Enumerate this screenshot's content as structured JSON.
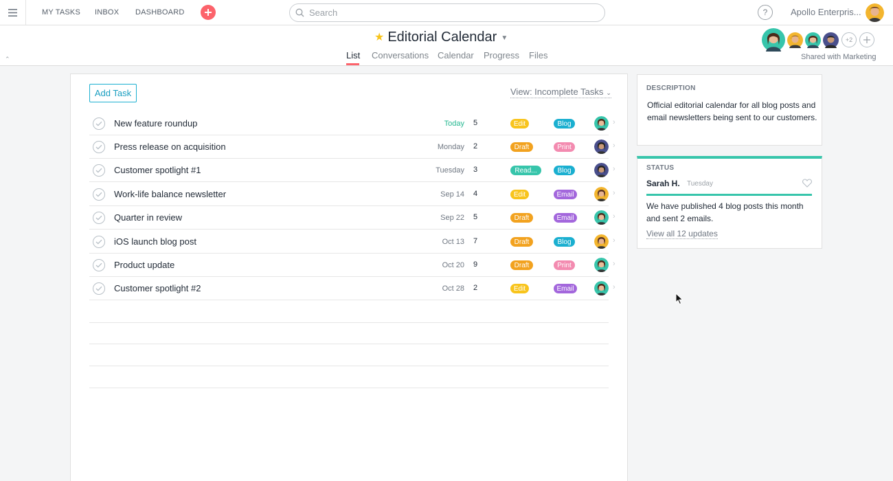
{
  "topbar": {
    "nav": [
      "MY TASKS",
      "INBOX",
      "DASHBOARD"
    ],
    "search_placeholder": "Search",
    "help": "?",
    "org_name": "Apollo Enterpris..."
  },
  "project": {
    "title": "Editorial Calendar",
    "tabs": [
      "List",
      "Conversations",
      "Calendar",
      "Progress",
      "Files"
    ],
    "active_tab": "List",
    "members_extra": "+2",
    "shared_label": "Shared with Marketing"
  },
  "list": {
    "add_task_label": "Add Task",
    "view_label": "View: Incomplete Tasks",
    "tasks": [
      {
        "name": "New feature roundup",
        "due": "Today",
        "count": "5",
        "tag1": "Edit",
        "tag2": "Blog"
      },
      {
        "name": "Press release on acquisition",
        "due": "Monday",
        "count": "2",
        "tag1": "Draft",
        "tag2": "Print"
      },
      {
        "name": "Customer spotlight #1",
        "due": "Tuesday",
        "count": "3",
        "tag1": "Read...",
        "tag2": "Blog"
      },
      {
        "name": "Work-life balance newsletter",
        "due": "Sep 14",
        "count": "4",
        "tag1": "Edit",
        "tag2": "Email"
      },
      {
        "name": "Quarter in review",
        "due": "Sep 22",
        "count": "5",
        "tag1": "Draft",
        "tag2": "Email"
      },
      {
        "name": "iOS launch blog post",
        "due": "Oct 13",
        "count": "7",
        "tag1": "Draft",
        "tag2": "Blog"
      },
      {
        "name": "Product update",
        "due": "Oct 20",
        "count": "9",
        "tag1": "Draft",
        "tag2": "Print"
      },
      {
        "name": "Customer spotlight #2",
        "due": "Oct 28",
        "count": "2",
        "tag1": "Edit",
        "tag2": "Email"
      }
    ]
  },
  "tag_colors": {
    "Edit": "#f8c41c",
    "Draft": "#f2a21f",
    "Read...": "#37c5ab",
    "Blog": "#1aafd0",
    "Print": "#f38bb0",
    "Email": "#a367dc"
  },
  "description": {
    "heading": "DESCRIPTION",
    "text": "Official editorial calendar for all blog posts and email newsletters being sent to our customers."
  },
  "status": {
    "heading": "STATUS",
    "author": "Sarah H.",
    "date": "Tuesday",
    "text": "We have published 4 blog posts this month and sent 2 emails.",
    "link": "View all 12 updates"
  },
  "colors": {
    "accent": "#fc636b",
    "status_green": "#37c5ab",
    "today_green": "#25b891",
    "link_blue": "#1aafd0"
  }
}
